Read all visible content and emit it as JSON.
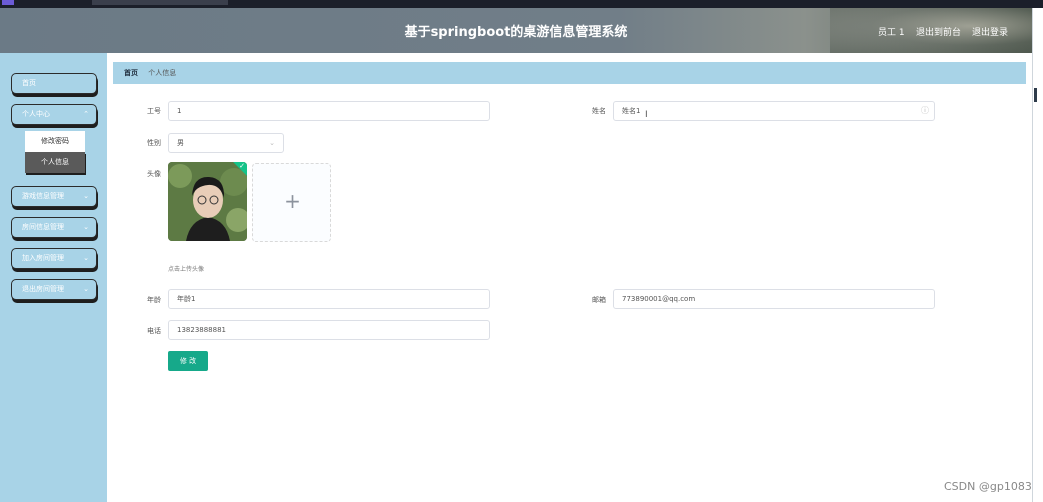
{
  "header": {
    "title": "基于springboot的桌游信息管理系统",
    "user": "员工 1",
    "back_label": "退出到前台",
    "logout_label": "退出登录"
  },
  "sidebar": {
    "items": [
      {
        "label": "首页"
      },
      {
        "label": "个人中心"
      },
      {
        "label": "游戏信息管理"
      },
      {
        "label": "房间信息管理"
      },
      {
        "label": "加入房间管理"
      },
      {
        "label": "退出房间管理"
      }
    ],
    "submenu": [
      {
        "label": "修改密码"
      },
      {
        "label": "个人信息"
      }
    ]
  },
  "breadcrumb": {
    "home": "首页",
    "current": "个人信息"
  },
  "form": {
    "job_no_label": "工号",
    "job_no_value": "1",
    "name_label": "姓名",
    "name_value": "姓名1",
    "gender_label": "性别",
    "gender_value": "男",
    "avatar_label": "头像",
    "avatar_hint": "点击上传头像",
    "age_label": "年龄",
    "age_value": "年龄1",
    "email_label": "邮箱",
    "email_value": "773890001@qq.com",
    "phone_label": "电话",
    "phone_value": "13823888881",
    "submit_label": "修 改"
  },
  "icons": {
    "upload": "+",
    "check": "✓"
  },
  "watermark": "CSDN @gp1083",
  "colors": {
    "sidebar": "#a8d3e7",
    "submit": "#16a98a"
  }
}
